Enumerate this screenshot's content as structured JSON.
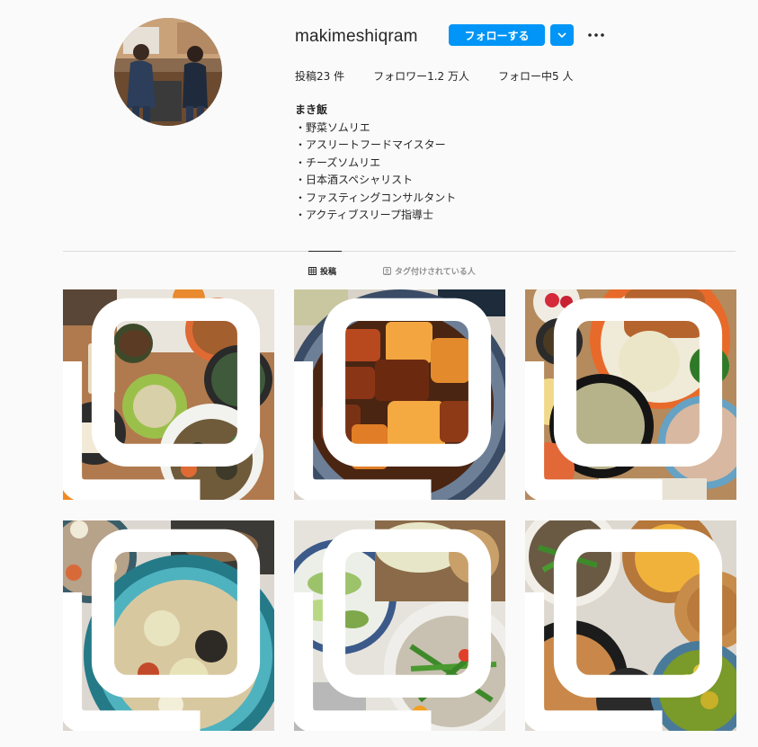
{
  "profile": {
    "username": "makimeshiqram",
    "follow_label": "フォローする",
    "stats": {
      "posts": "投稿23 件",
      "followers": "フォロワー1.2 万人",
      "following": "フォロー中5 人"
    },
    "bio_name": "まき飯",
    "bio_lines": [
      "・野菜ソムリエ",
      "・アスリートフードマイスター",
      "・チーズソムリエ",
      "・日本酒スペシャリスト",
      "・ファスティングコンサルタント",
      "・アクティブスリープ指導士"
    ]
  },
  "tabs": [
    {
      "label": "投稿",
      "icon": "grid-icon",
      "active": true
    },
    {
      "label": "タグ付けされている人",
      "icon": "tag-person-icon",
      "active": false
    }
  ],
  "posts": [
    {
      "icon": "multi-image-icon"
    },
    {
      "icon": "multi-image-icon"
    },
    {
      "icon": "multi-image-icon"
    },
    {
      "icon": "multi-image-icon"
    },
    {
      "icon": "multi-image-icon"
    },
    {
      "icon": "multi-image-icon"
    }
  ],
  "colors": {
    "accent": "#0095f6",
    "text": "#262626",
    "muted": "#8e8e8e",
    "divider": "#dbdbdb",
    "background": "#fafafa"
  }
}
